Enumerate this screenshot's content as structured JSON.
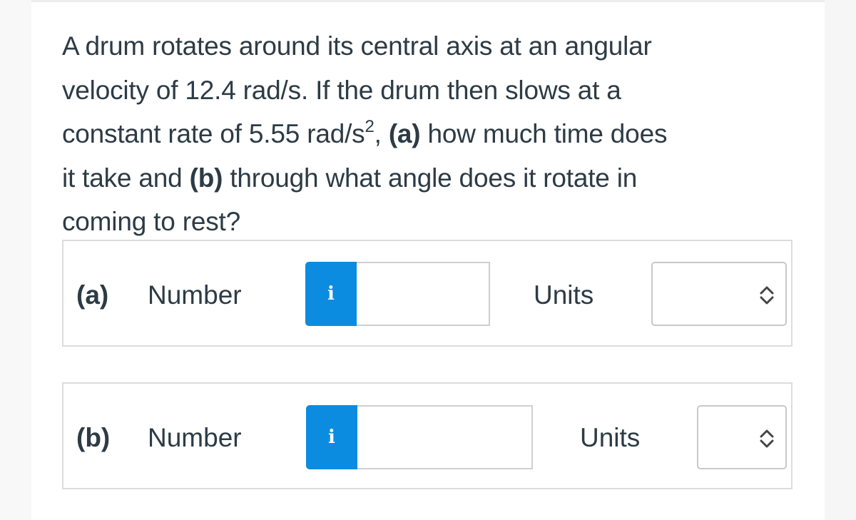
{
  "question": {
    "line1": "A drum rotates around its central axis at an angular",
    "line2": "velocity of 12.4 rad/s. If the drum then slows at a",
    "line3_pre": "constant rate of 5.55 rad/s",
    "line3_sup": "2",
    "line3_comma": ", ",
    "line3_part": "(a)",
    "line3_post": " how much time does",
    "line4_pre": "it take and ",
    "line4_part": "(b)",
    "line4_post": " through what angle does it rotate in",
    "line5": "coming to rest?"
  },
  "parts": [
    {
      "letter": "(a)",
      "number_label": "Number",
      "info_icon": "i",
      "number_value": "",
      "units_label": "Units",
      "units_selected": ""
    },
    {
      "letter": "(b)",
      "number_label": "Number",
      "info_icon": "i",
      "number_value": "",
      "units_label": "Units",
      "units_selected": ""
    }
  ],
  "colors": {
    "info_button": "#0b8ce0",
    "text": "#2d3b45"
  }
}
